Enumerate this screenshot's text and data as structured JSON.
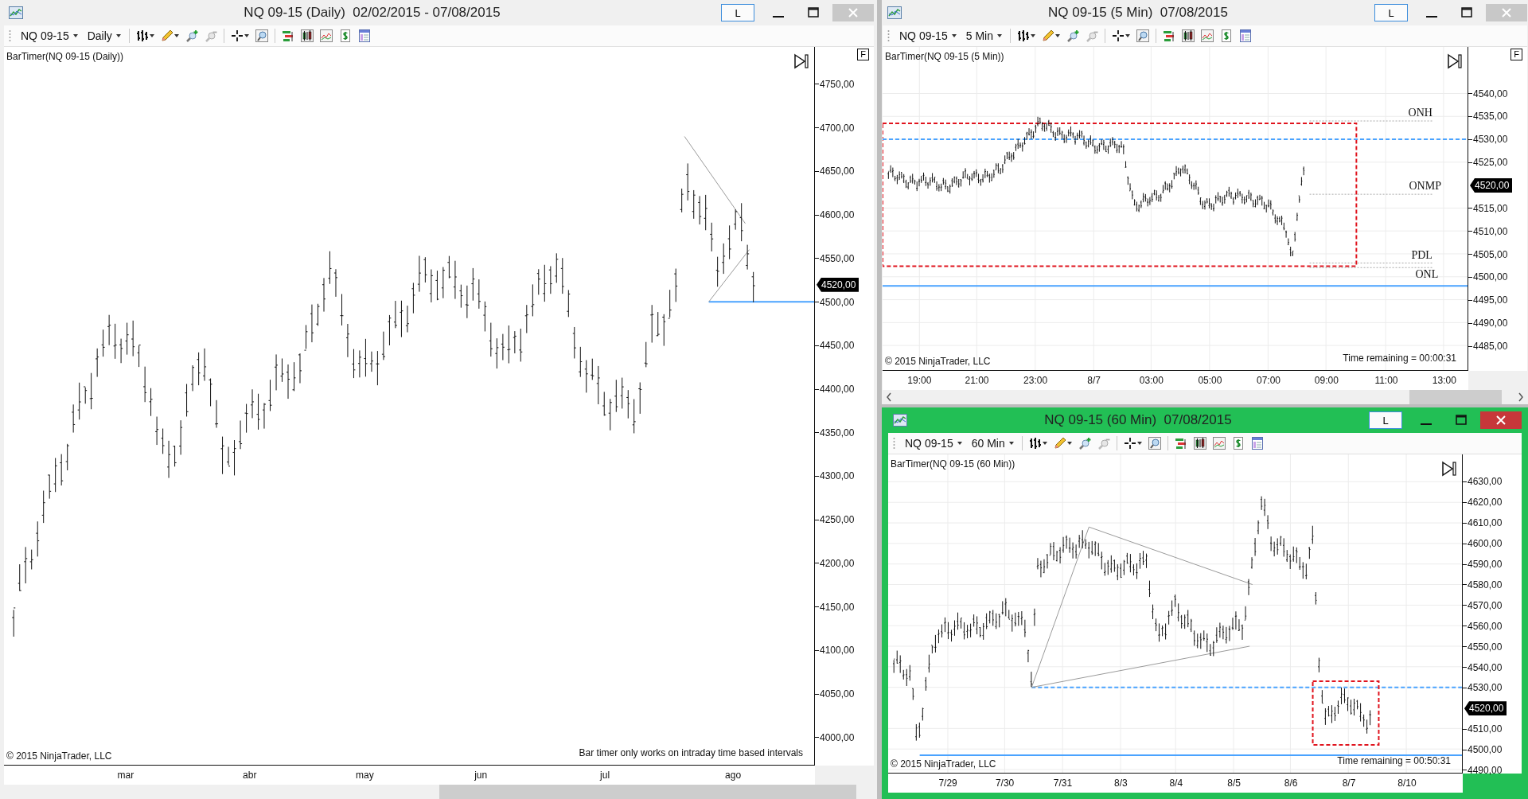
{
  "windows": [
    {
      "title": "NQ 09-15 (Daily)  02/02/2015 - 07/08/2015",
      "active": false,
      "layout_button": "L",
      "toolbar": {
        "instrument": "NQ 09-15",
        "interval": "Daily"
      },
      "indicator": "BarTimer(NQ 09-15 (Daily))",
      "flag_button": "F",
      "copyright": "© 2015 NinjaTrader, LLC",
      "message": "Bar timer only works on intraday time based intervals",
      "current_price": "4520,00",
      "price_labels": [
        "4750,00",
        "4700,00",
        "4650,00",
        "4600,00",
        "4550,00",
        "4500,00",
        "4450,00",
        "4400,00",
        "4350,00",
        "4300,00",
        "4250,00",
        "4200,00",
        "4150,00",
        "4100,00",
        "4050,00",
        "4000,00"
      ],
      "time_labels": [
        "mar",
        "abr",
        "may",
        "jun",
        "jul",
        "ago"
      ]
    },
    {
      "title": "NQ 09-15 (5 Min)  07/08/2015",
      "active": false,
      "layout_button": "L",
      "toolbar": {
        "instrument": "NQ 09-15",
        "interval": "5 Min"
      },
      "indicator": "BarTimer(NQ 09-15 (5 Min))",
      "flag_button": "F",
      "copyright": "© 2015 NinjaTrader, LLC",
      "message": "Time remaining = 00:00:31",
      "current_price": "4520,00",
      "price_labels": [
        "4540,00",
        "4535,00",
        "4530,00",
        "4525,00",
        "4515,00",
        "4510,00",
        "4505,00",
        "4500,00",
        "4495,00",
        "4490,00",
        "4485,00"
      ],
      "time_labels": [
        "19:00",
        "21:00",
        "23:00",
        "8/7",
        "03:00",
        "05:00",
        "07:00",
        "09:00",
        "11:00",
        "13:00"
      ],
      "level_labels": [
        "ONH",
        "ONMP",
        "PDL",
        "ONL"
      ]
    },
    {
      "title": "NQ 09-15 (60 Min)  07/08/2015",
      "active": true,
      "layout_button": "L",
      "toolbar": {
        "instrument": "NQ 09-15",
        "interval": "60 Min"
      },
      "indicator": "BarTimer(NQ 09-15 (60 Min))",
      "copyright": "© 2015 NinjaTrader, LLC",
      "message": "Time remaining = 00:50:31",
      "current_price": "4520,00",
      "price_labels": [
        "4630,00",
        "4620,00",
        "4610,00",
        "4600,00",
        "4590,00",
        "4580,00",
        "4570,00",
        "4560,00",
        "4550,00",
        "4540,00",
        "4530,00",
        "4510,00",
        "4500,00",
        "4490,00"
      ],
      "time_labels": [
        "7/29",
        "7/30",
        "7/31",
        "8/3",
        "8/4",
        "8/5",
        "8/6",
        "8/7",
        "8/10"
      ]
    }
  ]
}
